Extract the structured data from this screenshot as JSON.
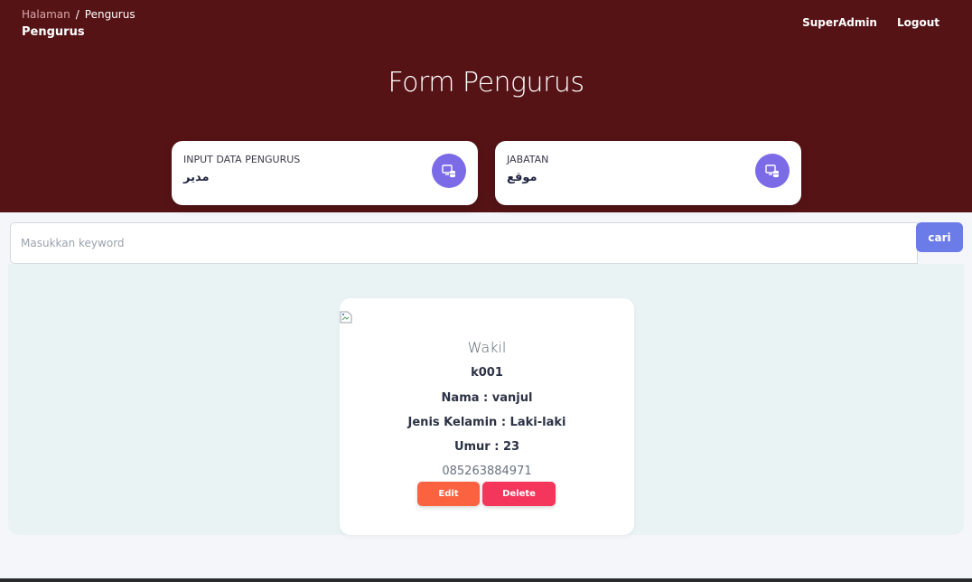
{
  "breadcrumb": {
    "root": "Halaman",
    "separator": "/",
    "current": "Pengurus"
  },
  "page_subtitle": "Pengurus",
  "topnav": {
    "user": "SuperAdmin",
    "logout": "Logout"
  },
  "hero": {
    "title": "Form Pengurus"
  },
  "cards": [
    {
      "label": "INPUT DATA PENGURUS",
      "value": "مدير",
      "icon": "database-monitor-icon"
    },
    {
      "label": "JABATAN",
      "value": "موقع",
      "icon": "database-monitor-icon"
    }
  ],
  "search": {
    "placeholder": "Masukkan keyword",
    "value": "",
    "button": "cari"
  },
  "member": {
    "image_icon": "broken-image-icon",
    "role": "Wakil",
    "code": "k001",
    "name_line": "Nama : vanjul",
    "gender_line": "Jenis Kelamin : Laki-laki",
    "age_line": "Umur : 23",
    "phone": "085263884971",
    "edit": "Edit",
    "delete": "Delete"
  },
  "colors": {
    "hero_bg": "#561316",
    "icon_accent": "#7b6be6",
    "search_button": "#6b7be8",
    "edit_button": "#fb6340",
    "delete_button": "#f5365c",
    "panel_bg": "#eaf3f4"
  }
}
